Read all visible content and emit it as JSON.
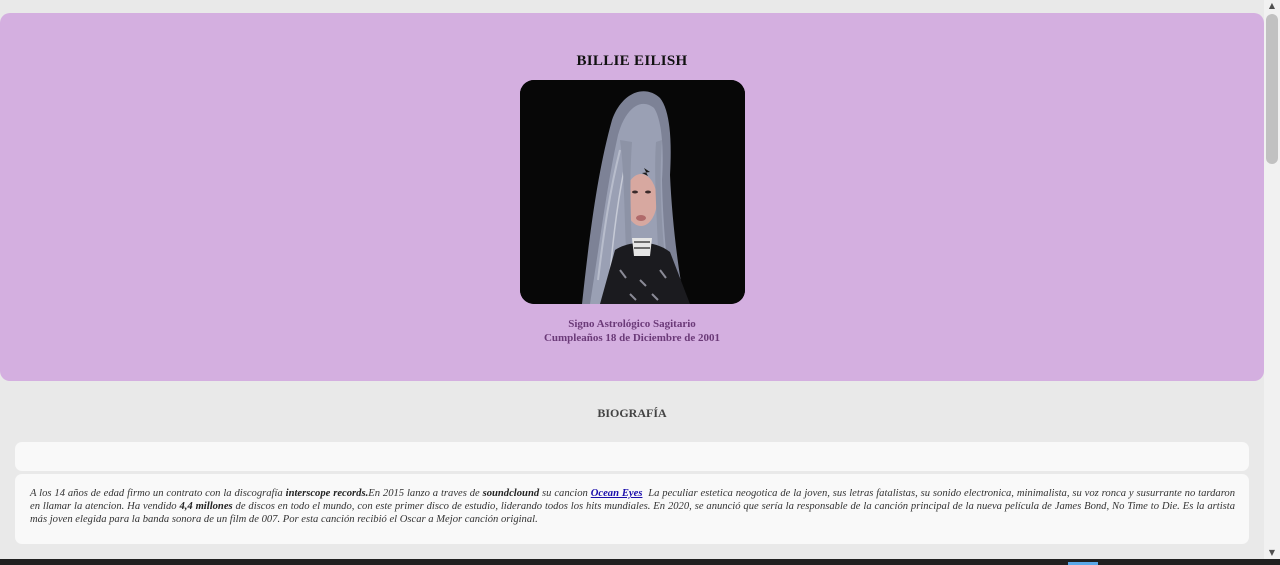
{
  "artist": {
    "name": "BILLIE EILISH",
    "photo_alt": "Billie Eilish",
    "sign_line": "Signo Astrológico Sagitario",
    "birthday_line": "Cumpleaños 18 de Diciembre de 2001"
  },
  "biography": {
    "heading": "BIOGRAFÍA",
    "part1": "A los 14 años de edad firmo un contrato con la discografía ",
    "label_bold": "interscope records.",
    "part2": "En 2015 lanzo a traves de ",
    "platform_bold": "soundclound",
    "part3": " su cancion ",
    "song_link": "Ocean Eyes",
    "part4": " La peculiar estetica neogotica de la joven, sus letras fatalistas, su sonido electronica, minimalista, su voz ronca y susurrante no tardaron en llamar la atencion. Ha vendido ",
    "sales_bold": "4,4 millones",
    "part5": " de discos en todo el mundo, con este primer disco de estudio, liderando todos los hits mundiales. En 2020, se anunció que sería la responsable de la canción principal de la nueva película de James Bond, No Time to Die. Es la artista más joven elegida para la banda sonora de un film de 007. Por esta canción recibió el Oscar a Mejor canción original."
  },
  "colors": {
    "hero_background": "#d4afe0",
    "page_background": "#e9e9e9",
    "card_background": "#f9f9f9",
    "info_text": "#6b3a78",
    "link": "#1a0dab"
  }
}
